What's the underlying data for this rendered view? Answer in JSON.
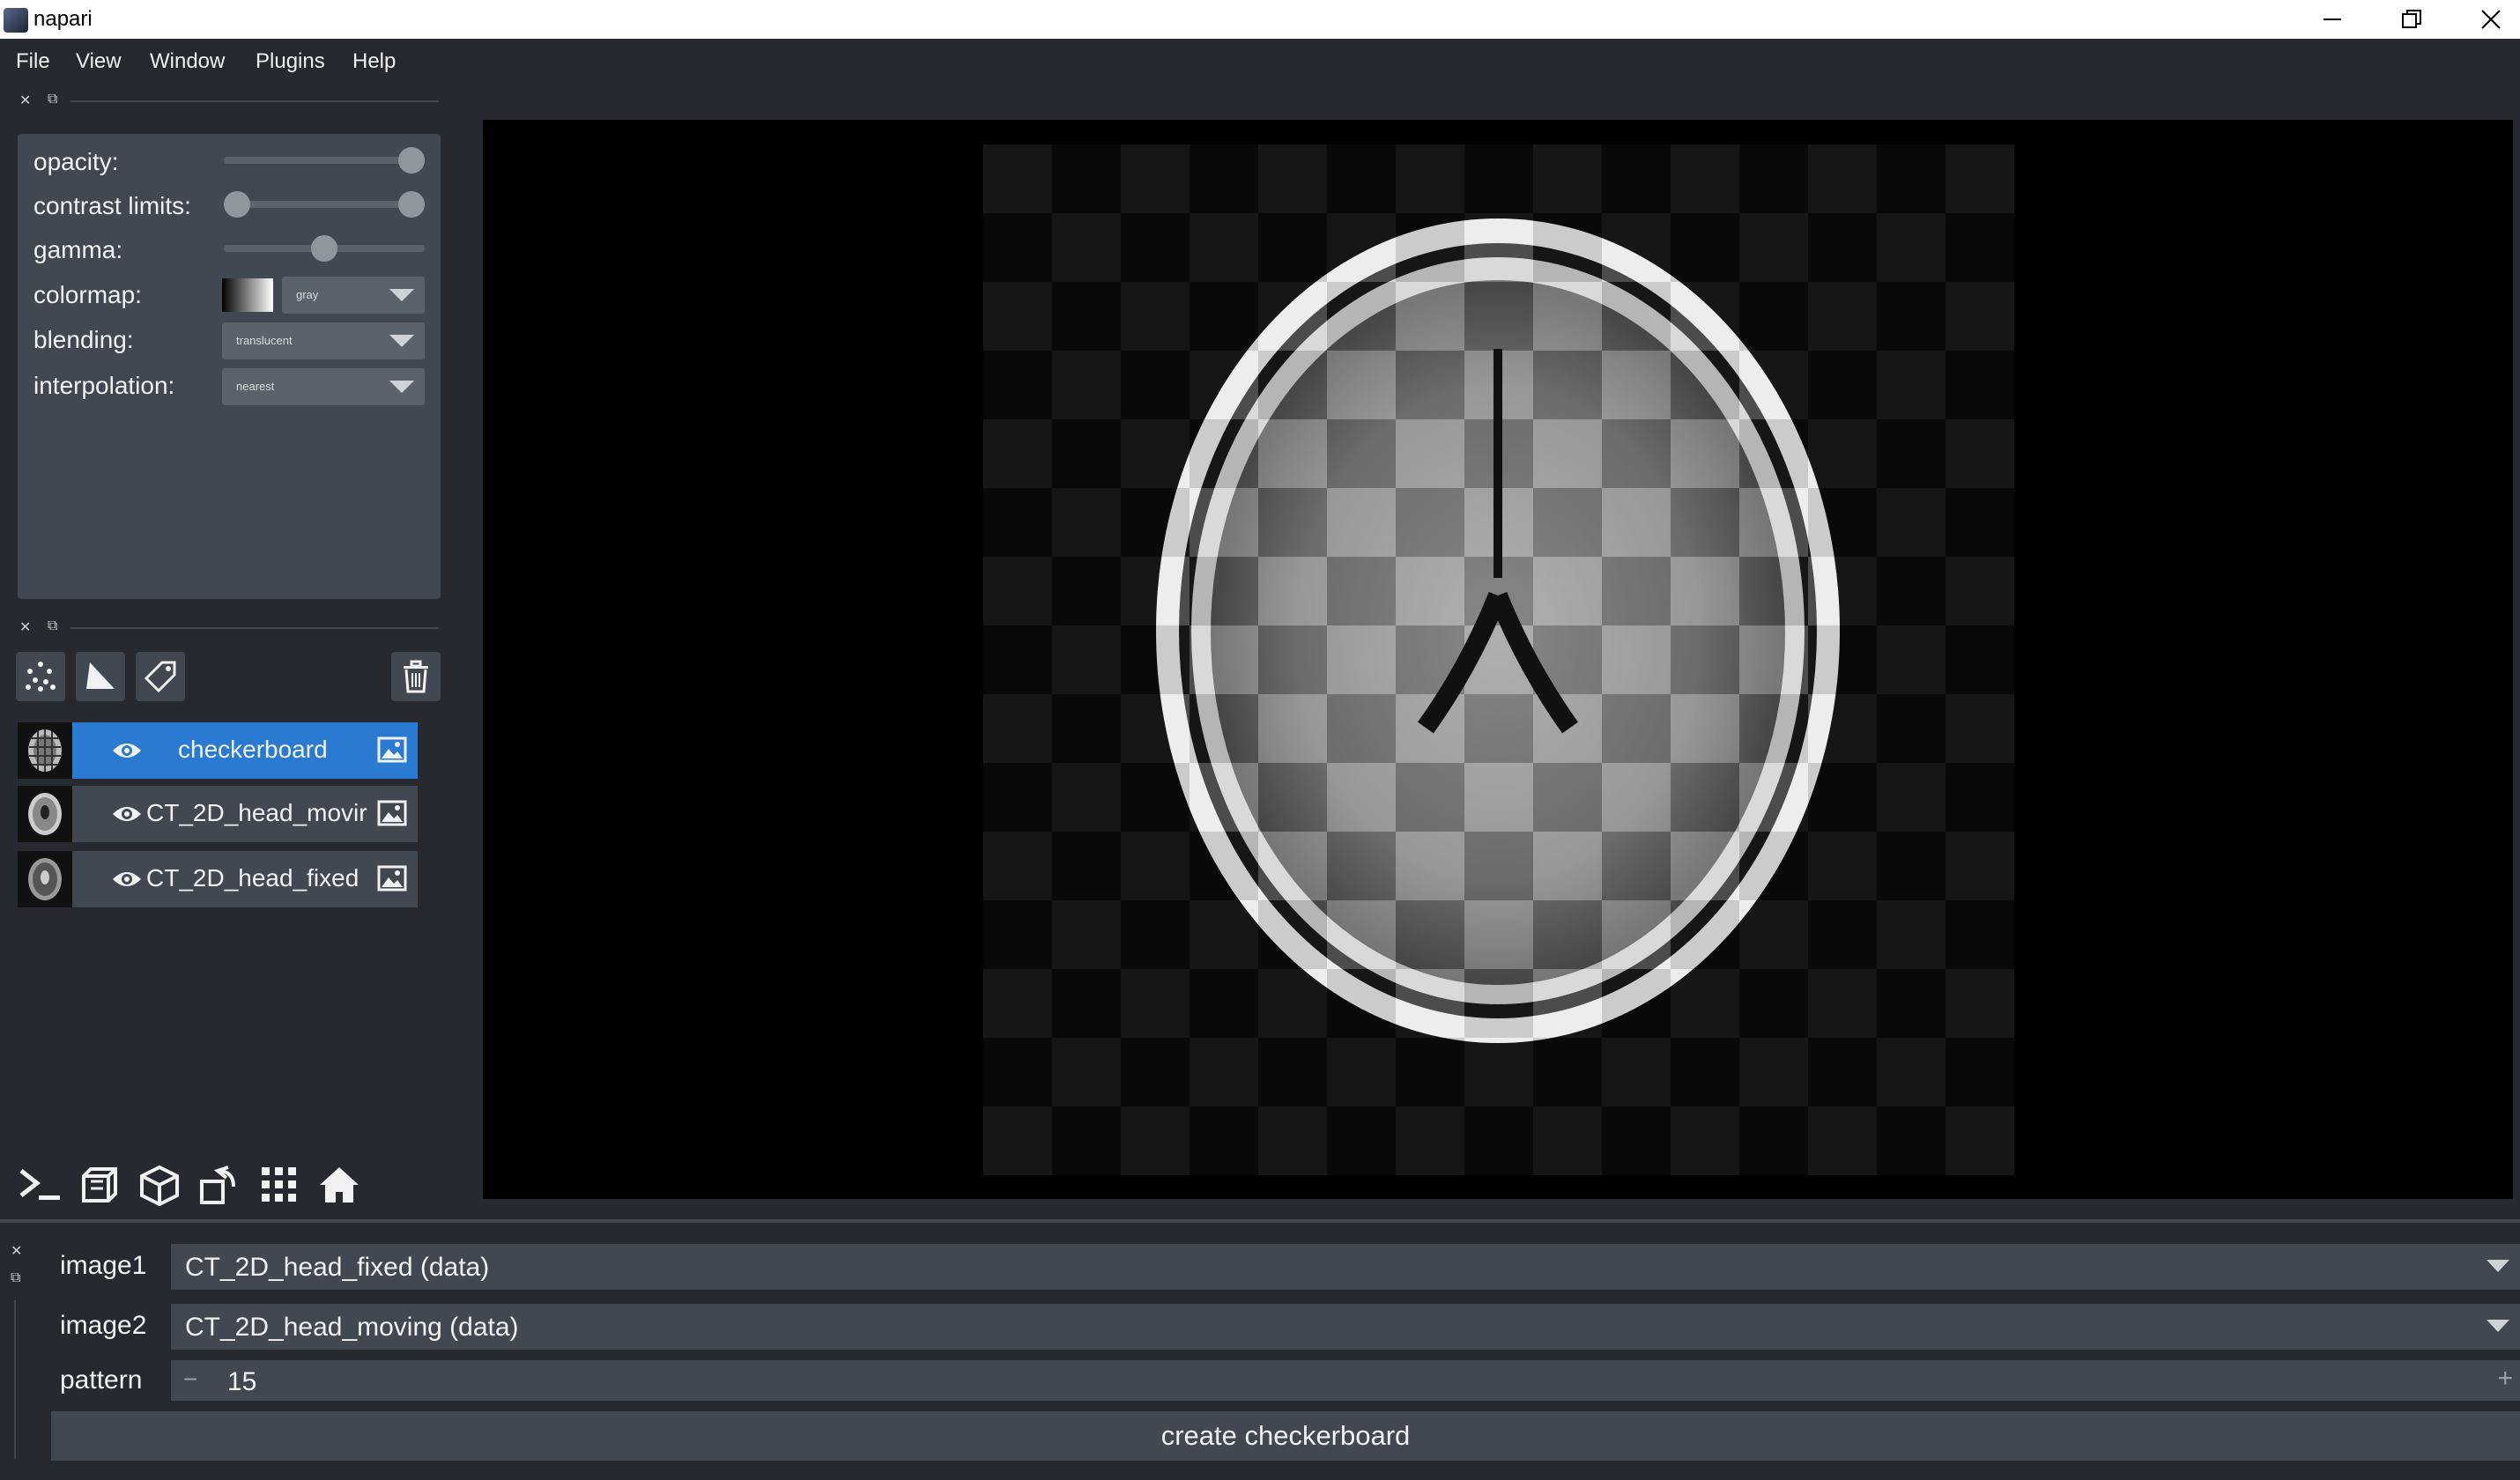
{
  "window": {
    "title": "napari",
    "minimize_icon": "minimize-icon",
    "restore_icon": "restore-icon",
    "close_icon": "close-icon"
  },
  "menu": [
    "File",
    "View",
    "Window",
    "Plugins",
    "Help"
  ],
  "layer_controls": {
    "opacity_label": "opacity:",
    "opacity_value": 1.0,
    "contrast_label": "contrast limits:",
    "contrast_range": [
      0.0,
      1.0
    ],
    "gamma_label": "gamma:",
    "gamma_value": 0.5,
    "colormap_label": "colormap:",
    "colormap_value": "gray",
    "blending_label": "blending:",
    "blending_value": "translucent",
    "interpolation_label": "interpolation:",
    "interpolation_value": "nearest"
  },
  "layer_buttons": [
    "new-points-icon",
    "new-shapes-icon",
    "new-labels-icon",
    "delete-layer-icon"
  ],
  "layers": [
    {
      "name": "checkerboard",
      "selected": true,
      "visible": true
    },
    {
      "name": "CT_2D_head_movir",
      "selected": false,
      "visible": true
    },
    {
      "name": "CT_2D_head_fixed",
      "selected": false,
      "visible": true
    }
  ],
  "viewer_buttons": [
    "console-icon",
    "ndisplay-icon",
    "roll-dims-icon",
    "transpose-icon",
    "grid-icon",
    "home-icon"
  ],
  "colors": {
    "background": "#262930",
    "panel": "#414851",
    "accent": "#2a7ad2",
    "text": "#f0f1f2"
  },
  "widget": {
    "image1_label": "image1",
    "image1_value": "CT_2D_head_fixed (data)",
    "image2_label": "image2",
    "image2_value": "CT_2D_head_moving (data)",
    "pattern_label": "pattern",
    "pattern_value": "15",
    "minus": "−",
    "plus": "+",
    "button": "create checkerboard"
  }
}
